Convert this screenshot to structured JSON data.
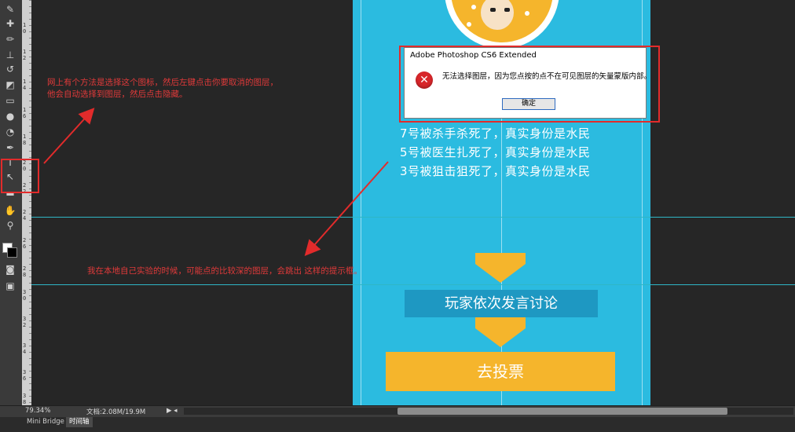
{
  "annotations": {
    "note_top": [
      "网上有个方法是选择这个图标，然后左键点击你要取消的图层，",
      "他会自动选择到图层，然后点击隐藏。"
    ],
    "note_bottom": "我在本地自己实验的时候，可能点的比较深的图层，会跳出 这样的提示框。",
    "accent_color": "#e22b2b"
  },
  "dialog": {
    "title": "Adobe Photoshop CS6 Extended",
    "message": "无法选择图层，因为您点按的点不在可见图层的矢量蒙版内部。",
    "ok_label": "确定",
    "icon": "error-icon"
  },
  "canvas_content": {
    "lines": [
      "7号被杀手杀死了，真实身份是水民",
      "5号被医生扎死了，真实身份是水民",
      "3号被狙击狙死了，真实身份是水民"
    ],
    "discuss_label": "玩家依次发言讨论",
    "vote_label": "去投票",
    "bg_color": "#2bbbe0",
    "accent_color": "#f5b52c"
  },
  "status": {
    "zoom": "79.34%",
    "doc_info": "文档:2.08M/19.9M"
  },
  "panel_tabs": [
    "Mini Bridge",
    "时间轴"
  ],
  "ruler_numbers": [
    "1",
    "0",
    "1",
    "2",
    "1",
    "4",
    "1",
    "6",
    "1",
    "8",
    "2",
    "0",
    "2",
    "2",
    "2",
    "4",
    "2",
    "6",
    "2",
    "8",
    "3",
    "0",
    "3",
    "2",
    "3",
    "4",
    "3",
    "6",
    "3",
    "8"
  ],
  "tools": [
    "brush-icon",
    "healing-icon",
    "pencil-icon",
    "stamp-icon",
    "history-brush-icon",
    "eraser-icon",
    "gradient-icon",
    "blur-icon",
    "dodge-icon",
    "pen-icon",
    "type-icon",
    "path-select-icon",
    "shape-icon",
    "hand-icon",
    "zoom-icon",
    "quick-mask-icon",
    "screen-mode-icon"
  ]
}
